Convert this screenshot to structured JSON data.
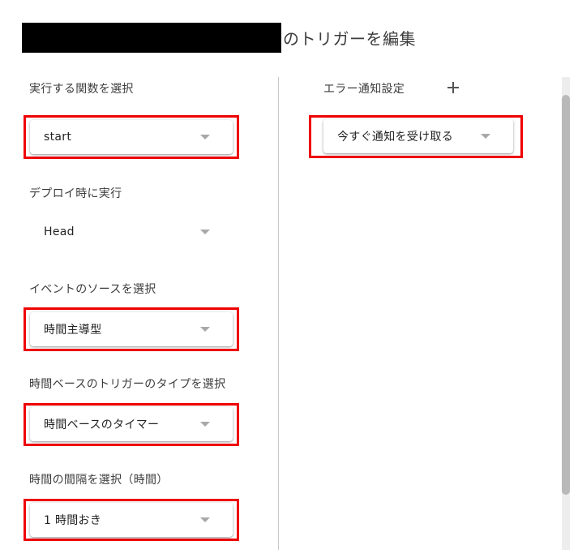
{
  "header": {
    "title_suffix": "のトリガーを編集",
    "redacted": true
  },
  "left_column": {
    "fields": [
      {
        "label": "実行する関数を選択",
        "value": "start",
        "highlighted": true
      },
      {
        "label": "デプロイ時に実行",
        "value": "Head",
        "highlighted": false
      },
      {
        "label": "イベントのソースを選択",
        "value": "時間主導型",
        "highlighted": true
      },
      {
        "label": "時間ベースのトリガーのタイプを選択",
        "value": "時間ベースのタイマー",
        "highlighted": true
      },
      {
        "label": "時間の間隔を選択（時間）",
        "value": "1 時間おき",
        "highlighted": true
      }
    ]
  },
  "right_column": {
    "section_label": "エラー通知設定",
    "add_icon": "plus-icon",
    "notification_select": {
      "value": "今すぐ通知を受け取る",
      "highlighted": true
    }
  },
  "icons": {
    "dropdown": "caret-down-icon"
  },
  "colors": {
    "highlight": "#ee0000",
    "divider": "#c8c8c8",
    "scrollbar_thumb": "#b9b9b9"
  }
}
